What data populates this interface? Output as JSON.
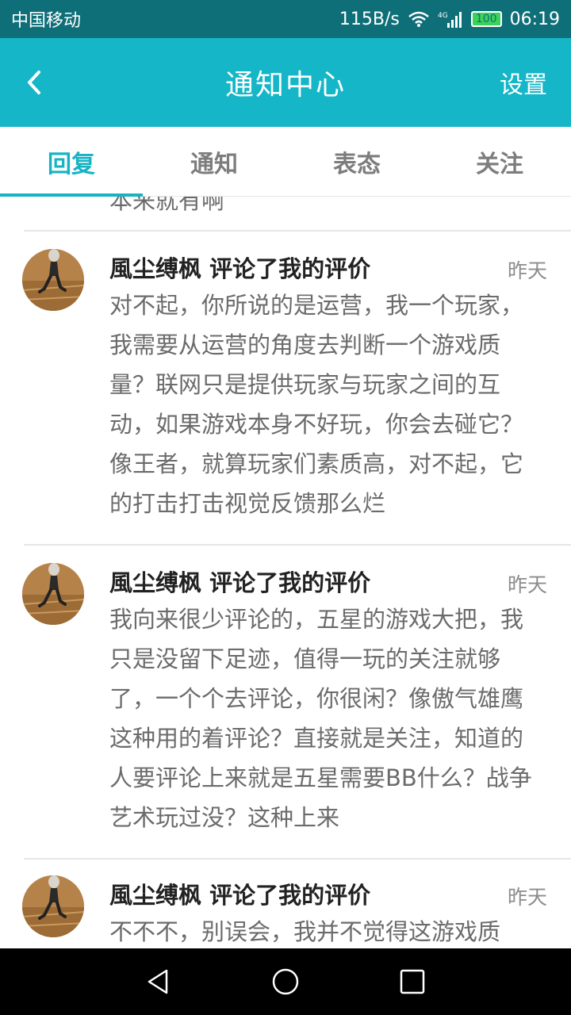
{
  "status_bar": {
    "carrier": "中国移动",
    "speed": "115B/s",
    "network": "4G",
    "battery": "100",
    "time": "06:19"
  },
  "header": {
    "back_icon": "chevron-left-icon",
    "title": "通知中心",
    "settings_label": "设置"
  },
  "tabs": [
    {
      "label": "回复",
      "active": true
    },
    {
      "label": "通知",
      "active": false
    },
    {
      "label": "表态",
      "active": false
    },
    {
      "label": "关注",
      "active": false
    }
  ],
  "feed": {
    "partial_previous_text": "本来就有啊",
    "items": [
      {
        "title": "風尘缚枫 评论了我的评价",
        "time": "昨天",
        "body": "对不起，你所说的是运营，我一个玩家，我需要从运营的角度去判断一个游戏质量？联网只是提供玩家与玩家之间的互动，如果游戏本身不好玩，你会去碰它？像王者，就算玩家们素质高，对不起，它的打击打击视觉反馈那么烂"
      },
      {
        "title": "風尘缚枫 评论了我的评价",
        "time": "昨天",
        "body": "我向来很少评论的，五星的游戏大把，我只是没留下足迹，值得一玩的关注就够了，一个个去评论，你很闲？像傲气雄鹰这种用的着评论？直接就是关注，知道的人要评论上来就是五星需要BB什么？战争艺术玩过没？这种上来"
      },
      {
        "title": "風尘缚枫 评论了我的评价",
        "time": "昨天",
        "body": "不不不，别误会，我并不觉得这游戏质"
      }
    ]
  },
  "colors": {
    "accent": "#15b3c4",
    "appbar": "#14b6c7",
    "statusbar": "#0f6f78"
  }
}
